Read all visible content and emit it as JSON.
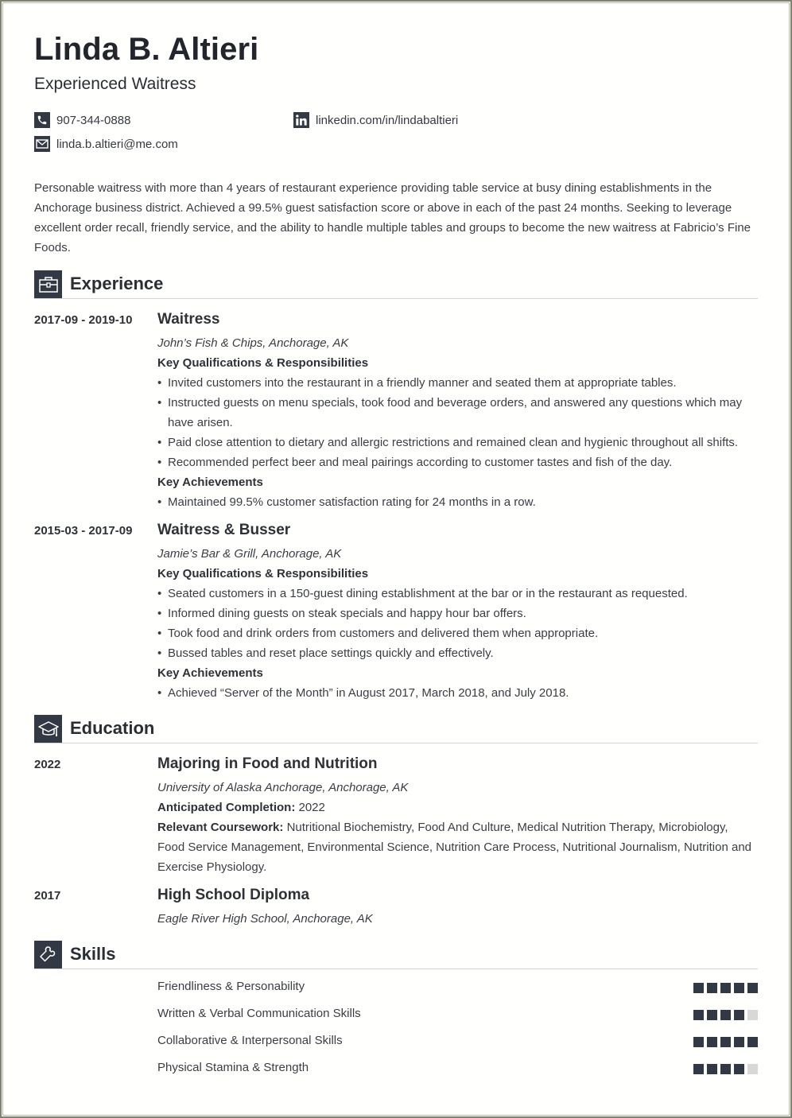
{
  "header": {
    "name": "Linda B. Altieri",
    "title": "Experienced Waitress",
    "contacts": {
      "phone": {
        "icon": "phone-icon",
        "value": "907-344-0888"
      },
      "linkedin": {
        "icon": "linkedin-icon",
        "value": "linkedin.com/in/lindabaltieri"
      },
      "email": {
        "icon": "email-icon",
        "value": "linda.b.altieri@me.com"
      }
    }
  },
  "summary": "Personable waitress with more than 4 years of restaurant experience providing table service at busy dining establishments in the Anchorage business district. Achieved a 99.5% guest satisfaction score or above in each of the past 24 months. Seeking to leverage excellent order recall, friendly service, and the ability to handle multiple tables and groups to become the new waitress at Fabricio’s Fine Foods.",
  "experience": {
    "heading": "Experience",
    "icon": "briefcase-icon",
    "jobs": [
      {
        "dates": "2017-09 - 2019-10",
        "role": "Waitress",
        "org": "John’s Fish & Chips, Anchorage, AK",
        "qual_heading": "Key Qualifications & Responsibilities",
        "qualifications": [
          "Invited customers into the restaurant in a friendly manner and seated them at appropriate tables.",
          "Instructed guests on menu specials, took food and beverage orders, and answered any questions which may have arisen.",
          "Paid close attention to dietary and allergic restrictions and remained clean and hygienic throughout all shifts.",
          "Recommended perfect beer and meal pairings according to customer tastes and fish of the day."
        ],
        "ach_heading": "Key Achievements",
        "achievements": [
          "Maintained 99.5% customer satisfaction rating for 24 months in a row."
        ]
      },
      {
        "dates": "2015-03 - 2017-09",
        "role": "Waitress & Busser",
        "org": "Jamie’s Bar & Grill, Anchorage, AK",
        "qual_heading": "Key Qualifications & Responsibilities",
        "qualifications": [
          "Seated customers in a 150-guest dining establishment at the bar or in the restaurant as requested.",
          "Informed dining guests on steak specials and happy hour bar offers.",
          "Took food and drink orders from customers and delivered them when appropriate.",
          "Bussed tables and reset place settings quickly and effectively."
        ],
        "ach_heading": "Key Achievements",
        "achievements": [
          "Achieved “Server of the Month” in August 2017, March 2018, and July 2018."
        ]
      }
    ]
  },
  "education": {
    "heading": "Education",
    "icon": "graduation-cap-icon",
    "items": [
      {
        "year": "2022",
        "degree": "Majoring in Food and Nutrition",
        "school": "University of Alaska Anchorage, Anchorage, AK",
        "completion_label": "Anticipated Completion:",
        "completion_value": "2022",
        "coursework_label": "Relevant Coursework:",
        "coursework_value": "Nutritional Biochemistry, Food And Culture, Medical Nutrition Therapy, Microbiology, Food Service Management, Environmental Science, Nutrition Care Process, Nutritional Journalism, Nutrition and Exercise Physiology."
      },
      {
        "year": "2017",
        "degree": "High School Diploma",
        "school": "Eagle River High School, Anchorage, AK"
      }
    ]
  },
  "skills": {
    "heading": "Skills",
    "icon": "puzzle-piece-icon",
    "max_rating": 5,
    "items": [
      {
        "name": "Friendliness & Personability",
        "rating": 5
      },
      {
        "name": "Written & Verbal Communication Skills",
        "rating": 4
      },
      {
        "name": "Collaborative & Interpersonal Skills",
        "rating": 5
      },
      {
        "name": "Physical Stamina & Strength",
        "rating": 4
      }
    ]
  },
  "colors": {
    "accent": "#323844",
    "rating_empty": "#d8d8d8",
    "rule": "#d4d4d4",
    "frame": "#7f8270"
  }
}
